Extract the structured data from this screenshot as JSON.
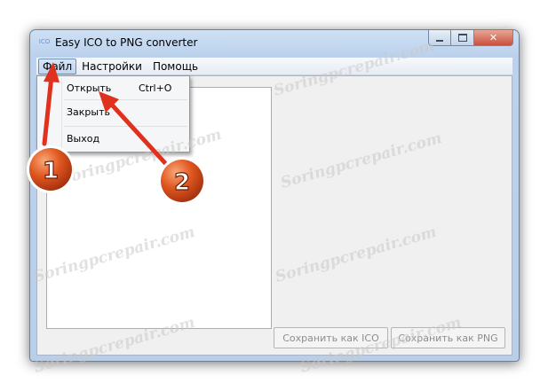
{
  "window": {
    "title": "Easy ICO to PNG converter",
    "icon_label": "ICO",
    "icon": "app-icon",
    "controls": {
      "minimize": "minimize-icon",
      "maximize": "maximize-icon",
      "close": "close-icon",
      "close_glyph": "✕"
    }
  },
  "menubar": {
    "items": [
      {
        "label": "Файл",
        "active": true
      },
      {
        "label": "Настройки",
        "active": false
      },
      {
        "label": "Помощь",
        "active": false
      }
    ]
  },
  "dropdown": {
    "items": [
      {
        "label": "Открыть",
        "shortcut": "Ctrl+O"
      },
      {
        "label": "Закрыть",
        "shortcut": ""
      },
      {
        "label": "Выход",
        "shortcut": ""
      }
    ]
  },
  "buttons": {
    "save_ico": "Сохранить как ICO",
    "save_png": "Сохранить как PNG"
  },
  "annotations": {
    "badge_1": "1",
    "badge_2": "2",
    "badge_color": "#e0561f",
    "arrow_color": "#e0301e"
  },
  "watermark": {
    "text": "Soringpcrepair.com",
    "color": "#c8c8c8"
  },
  "colors": {
    "disabled_text": "#8d8d8d",
    "frame": "#bcd2ec"
  }
}
